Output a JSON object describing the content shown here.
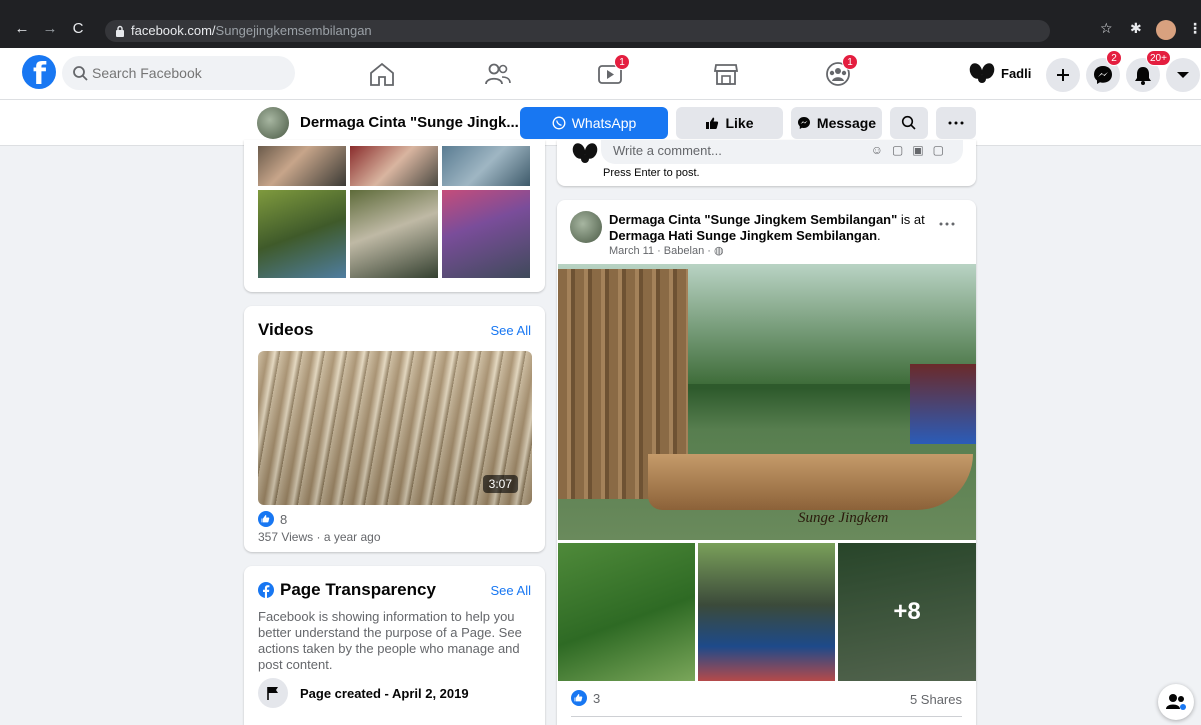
{
  "browser": {
    "url_domain": "facebook.com/",
    "url_path": "Sungejingkemsembilangan"
  },
  "topbar": {
    "search_placeholder": "Search Facebook",
    "watch_badge": "1",
    "groups_badge": "1",
    "profile_name": "Fadli",
    "messenger_badge": "2",
    "notifications_badge": "20+"
  },
  "page_bar": {
    "page_name": "Dermaga Cinta \"Sunge Jingk...",
    "whatsapp_label": "WhatsApp",
    "like_label": "Like",
    "message_label": "Message"
  },
  "videos": {
    "title": "Videos",
    "see_all": "See All",
    "duration": "3:07",
    "reactions": "8",
    "meta": "357 Views · a year ago"
  },
  "transparency": {
    "title": "Page Transparency",
    "see_all": "See All",
    "description": "Facebook is showing information to help you better understand the purpose of a Page. See actions taken by the people who manage and post content.",
    "created": "Page created - April 2, 2019"
  },
  "comment_box": {
    "placeholder": "Write a comment...",
    "hint": "Press Enter to post."
  },
  "post": {
    "author": "Dermaga Cinta \"Sunge Jingkem Sembilangan\"",
    "is_at": " is at ",
    "location": "Dermaga Hati Sunge Jingkem Sembilangan",
    "location_end": ".",
    "date": "March 11 · Babelan · ",
    "image_caption": "Sunge Jingkem",
    "more_count": "+8",
    "reactions": "3",
    "shares": "5 Shares"
  },
  "colors": {
    "fb_blue": "#1877f2",
    "badge_red": "#e41e3f",
    "background": "#f0f2f5"
  }
}
